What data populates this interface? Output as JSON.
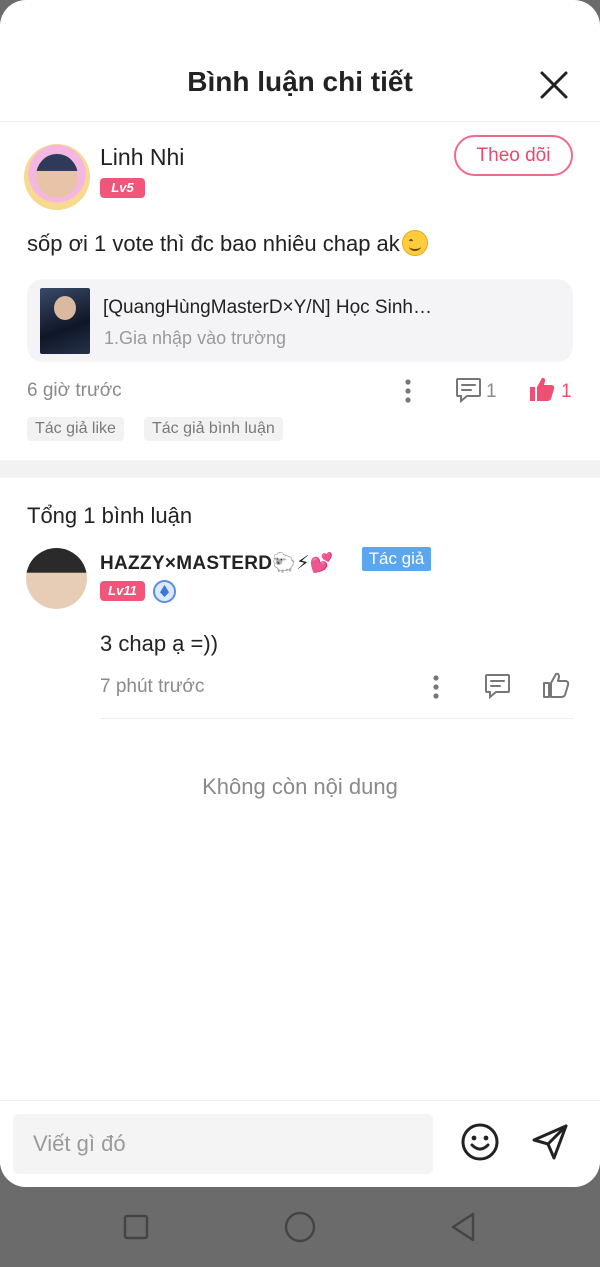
{
  "header": {
    "title": "Bình luận chi tiết",
    "close_icon": "close-icon"
  },
  "post": {
    "author_name": "Linh Nhi",
    "level": "Lv5",
    "follow_label": "Theo dõi",
    "content": "sốp ơi 1 vote thì đc bao nhiêu chap ak",
    "emoji": "smiling-face-emoji",
    "story": {
      "title": "[QuangHùngMasterD×Y/N] Học Sinh…",
      "chapter": "1.Gia nhập vào trường"
    },
    "time": "6 giờ trước",
    "comment_count": "1",
    "like_count": "1",
    "tags": [
      "Tác giả like",
      "Tác giả bình luận"
    ],
    "colors": {
      "accent": "#f06a8c",
      "like": "#ef4f73"
    }
  },
  "comments": {
    "total_label": "Tổng 1 bình luận",
    "items": [
      {
        "author_name": "HAZZY×MASTERD🐑⚡💕",
        "level": "Lv11",
        "author_badge": "Tác giả",
        "text": "3 chap ạ =))",
        "time": "7 phút trước"
      }
    ]
  },
  "end_label": "Không còn nội dung",
  "composer": {
    "placeholder": "Viết gì đó",
    "emoji_icon": "smiley-icon",
    "send_icon": "send-icon"
  },
  "system_nav": [
    "square-icon",
    "circle-icon",
    "back-triangle-icon"
  ]
}
